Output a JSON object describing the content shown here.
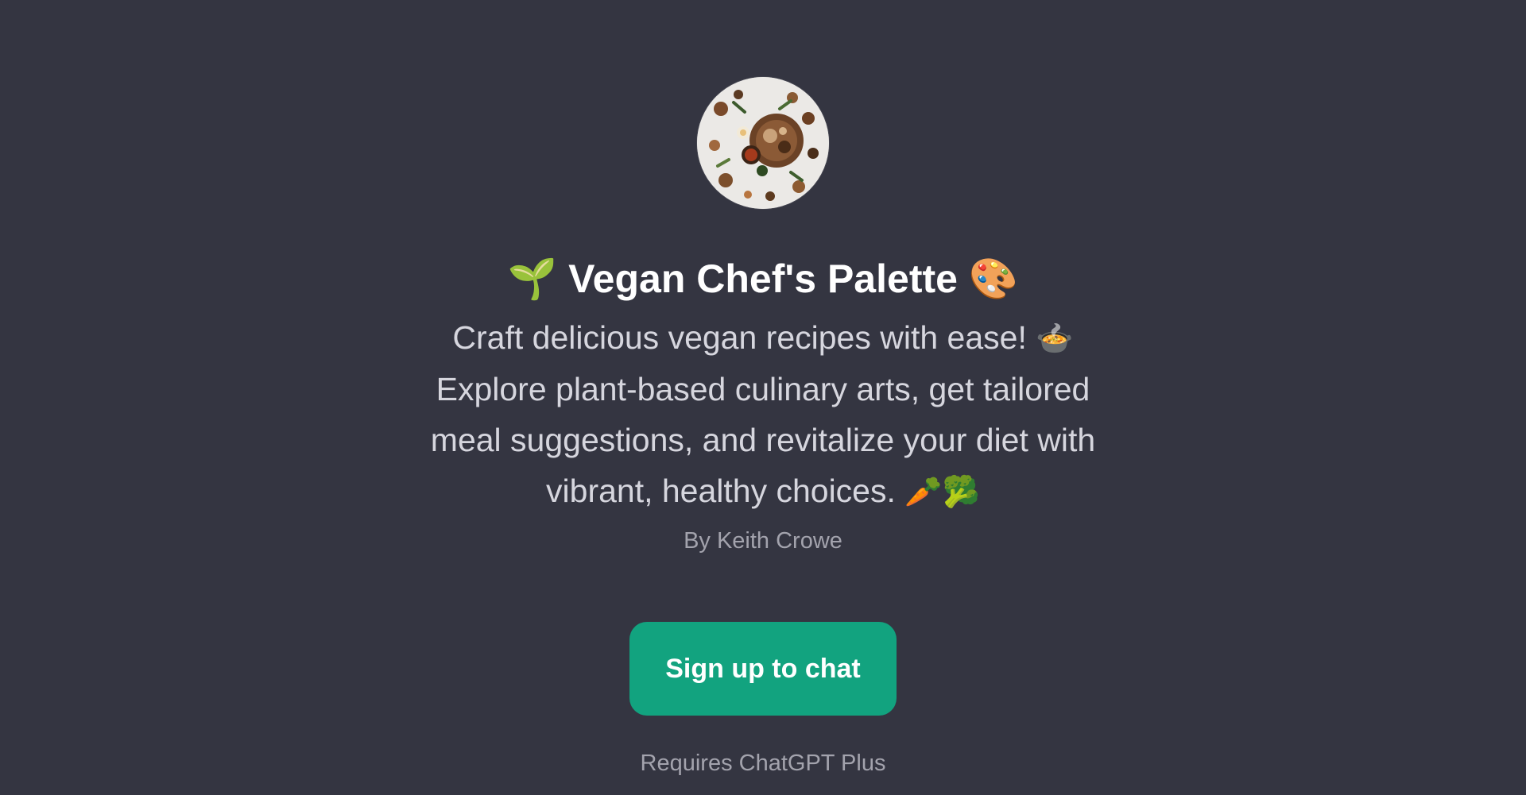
{
  "gpt": {
    "title": "Vegan Chef's Palette",
    "title_emoji_left": "🌱",
    "title_emoji_right": "🎨",
    "description_lines": [
      "Craft delicious vegan recipes with ease!",
      "Explore plant-based culinary arts, get tailored",
      "meal suggestions, and revitalize your diet with",
      "vibrant, healthy choices."
    ],
    "description_emojis": {
      "pot": "🍲",
      "carrot": "🥕",
      "broccoli": "🥦"
    },
    "author": "By Keith Crowe"
  },
  "actions": {
    "signup_label": "Sign up to chat",
    "requires_note": "Requires ChatGPT Plus"
  },
  "icons": {
    "avatar": "vegan-food-flatlay-avatar"
  },
  "colors": {
    "background": "#343541",
    "accent": "#12a37f",
    "title": "#ffffff",
    "description": "#d6d6de",
    "muted": "#a3a3ad"
  }
}
